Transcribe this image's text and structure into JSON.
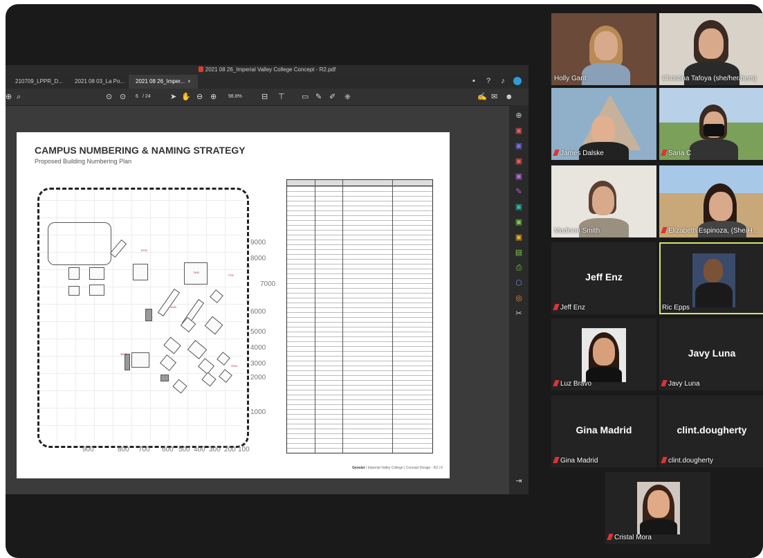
{
  "pdf_viewer": {
    "window_title": "2021 08 26_Imperial Valley College Concept - R2.pdf",
    "tabs": [
      {
        "label": "210709_LPPR_D..."
      },
      {
        "label": "2021 08 03_La Po..."
      },
      {
        "label": "2021 08 26_Imper..."
      }
    ],
    "toolbar": {
      "page_current": "6",
      "page_total": "/ 24",
      "zoom": "98.8%"
    },
    "slide": {
      "title": "CAMPUS NUMBERING & NAMING STRATEGY",
      "subtitle": "Proposed Building Numbering Plan",
      "footer_brand": "Gensler",
      "footer_text": "| Imperial Valley College | Concept Design - R2 | 6",
      "y_labels": [
        "9000",
        "8000",
        "7000",
        "6000",
        "5000",
        "4000",
        "3000",
        "2000",
        "1000"
      ],
      "x_labels": [
        "900",
        "800",
        "700",
        "600",
        "500",
        "400",
        "300",
        "200",
        "100"
      ]
    }
  },
  "participants": [
    {
      "name": "Holly Gant",
      "video": true
    },
    {
      "name": "Christina Tafoya (she/her/hers)",
      "video": true
    },
    {
      "name": "James Dalske",
      "video": true,
      "muted": true
    },
    {
      "name": "Saria C",
      "video": true,
      "muted": true
    },
    {
      "name": "Madison Smith",
      "video": true
    },
    {
      "name": "Elizabeth Espinoza, (She/H...",
      "video": true,
      "muted": true
    },
    {
      "name": "Jeff Enz",
      "display": "Jeff Enz",
      "muted": true
    },
    {
      "name": "Ric Epps",
      "video": true,
      "active_speaker": true
    },
    {
      "name": "Luz Bravo",
      "video": true,
      "muted": true
    },
    {
      "name": "Javy Luna",
      "display": "Javy Luna",
      "muted": true
    },
    {
      "name": "Gina Madrid",
      "display": "Gina Madrid",
      "muted": true
    },
    {
      "name": "clint.dougherty",
      "display": "clint.dougherty",
      "muted": true
    },
    {
      "name": "Cristal Mora",
      "video": true,
      "muted": true
    }
  ],
  "colors": {
    "active_speaker_border": "#d7e86b",
    "accent": "#2d9cdb",
    "mute": "#d33"
  }
}
